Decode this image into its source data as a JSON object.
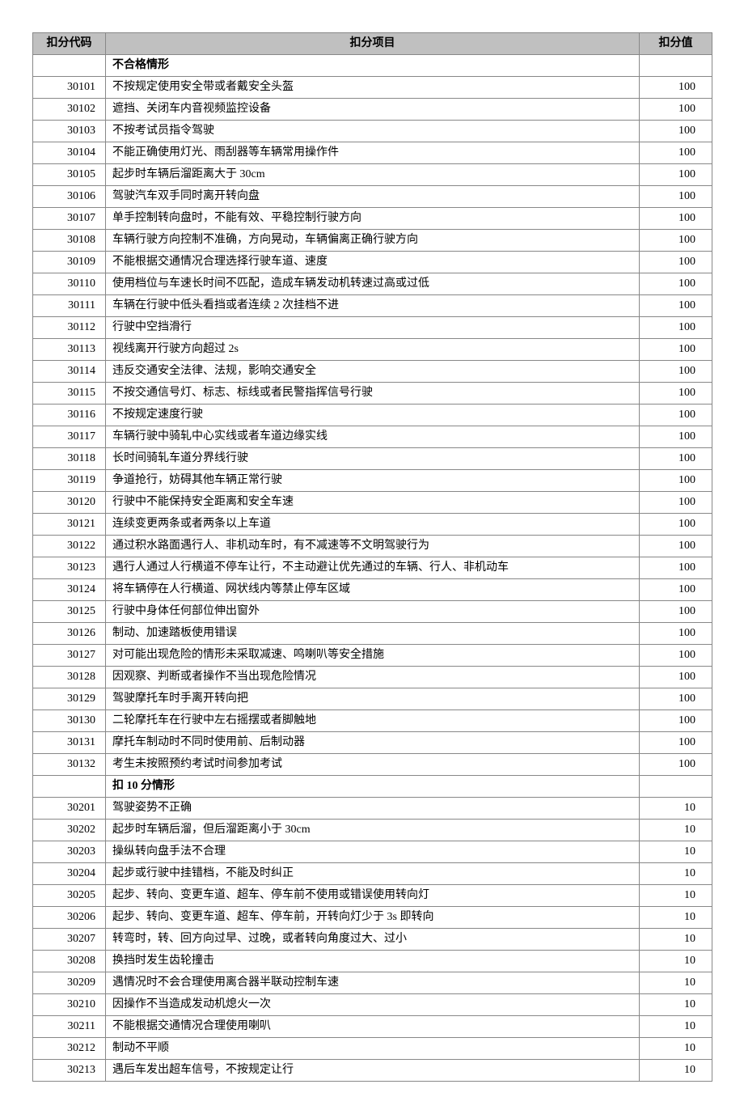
{
  "headers": {
    "code": "扣分代码",
    "item": "扣分项目",
    "value": "扣分值"
  },
  "sections": [
    {
      "title": "不合格情形",
      "rows": [
        {
          "code": "30101",
          "item": "不按规定使用安全带或者戴安全头盔",
          "value": "100"
        },
        {
          "code": "30102",
          "item": "遮挡、关闭车内音视频监控设备",
          "value": "100"
        },
        {
          "code": "30103",
          "item": "不按考试员指令驾驶",
          "value": "100"
        },
        {
          "code": "30104",
          "item": "不能正确使用灯光、雨刮器等车辆常用操作件",
          "value": "100"
        },
        {
          "code": "30105",
          "item": "起步时车辆后溜距离大于 30cm",
          "value": "100"
        },
        {
          "code": "30106",
          "item": "驾驶汽车双手同时离开转向盘",
          "value": "100"
        },
        {
          "code": "30107",
          "item": "单手控制转向盘时，不能有效、平稳控制行驶方向",
          "value": "100"
        },
        {
          "code": "30108",
          "item": "车辆行驶方向控制不准确，方向晃动，车辆偏离正确行驶方向",
          "value": "100"
        },
        {
          "code": "30109",
          "item": "不能根据交通情况合理选择行驶车道、速度",
          "value": "100"
        },
        {
          "code": "30110",
          "item": "使用档位与车速长时间不匹配，造成车辆发动机转速过高或过低",
          "value": "100"
        },
        {
          "code": "30111",
          "item": "车辆在行驶中低头看挡或者连续 2 次挂档不进",
          "value": "100"
        },
        {
          "code": "30112",
          "item": "行驶中空挡滑行",
          "value": "100"
        },
        {
          "code": "30113",
          "item": "视线离开行驶方向超过 2s",
          "value": "100"
        },
        {
          "code": "30114",
          "item": "违反交通安全法律、法规，影响交通安全",
          "value": "100"
        },
        {
          "code": "30115",
          "item": "不按交通信号灯、标志、标线或者民警指挥信号行驶",
          "value": "100"
        },
        {
          "code": "30116",
          "item": "不按规定速度行驶",
          "value": "100"
        },
        {
          "code": "30117",
          "item": "车辆行驶中骑轧中心实线或者车道边缘实线",
          "value": "100"
        },
        {
          "code": "30118",
          "item": "长时间骑轧车道分界线行驶",
          "value": "100"
        },
        {
          "code": "30119",
          "item": "争道抢行，妨碍其他车辆正常行驶",
          "value": "100"
        },
        {
          "code": "30120",
          "item": "行驶中不能保持安全距离和安全车速",
          "value": "100"
        },
        {
          "code": "30121",
          "item": "连续变更两条或者两条以上车道",
          "value": "100"
        },
        {
          "code": "30122",
          "item": "通过积水路面遇行人、非机动车时，有不减速等不文明驾驶行为",
          "value": "100"
        },
        {
          "code": "30123",
          "item": "遇行人通过人行横道不停车让行，不主动避让优先通过的车辆、行人、非机动车",
          "value": "100"
        },
        {
          "code": "30124",
          "item": "将车辆停在人行横道、网状线内等禁止停车区域",
          "value": "100"
        },
        {
          "code": "30125",
          "item": "行驶中身体任何部位伸出窗外",
          "value": "100"
        },
        {
          "code": "30126",
          "item": "制动、加速踏板使用错误",
          "value": "100"
        },
        {
          "code": "30127",
          "item": "对可能出现危险的情形未采取减速、鸣喇叭等安全措施",
          "value": "100"
        },
        {
          "code": "30128",
          "item": "因观察、判断或者操作不当出现危险情况",
          "value": "100"
        },
        {
          "code": "30129",
          "item": "驾驶摩托车时手离开转向把",
          "value": "100"
        },
        {
          "code": "30130",
          "item": "二轮摩托车在行驶中左右摇摆或者脚触地",
          "value": "100"
        },
        {
          "code": "30131",
          "item": "摩托车制动时不同时使用前、后制动器",
          "value": "100"
        },
        {
          "code": "30132",
          "item": "考生未按照预约考试时间参加考试",
          "value": "100"
        }
      ]
    },
    {
      "title": "扣 10 分情形",
      "rows": [
        {
          "code": "30201",
          "item": "驾驶姿势不正确",
          "value": "10"
        },
        {
          "code": "30202",
          "item": "起步时车辆后溜，但后溜距离小于 30cm",
          "value": "10"
        },
        {
          "code": "30203",
          "item": "操纵转向盘手法不合理",
          "value": "10"
        },
        {
          "code": "30204",
          "item": "起步或行驶中挂错档，不能及时纠正",
          "value": "10"
        },
        {
          "code": "30205",
          "item": "起步、转向、变更车道、超车、停车前不使用或错误使用转向灯",
          "value": "10"
        },
        {
          "code": "30206",
          "item": "起步、转向、变更车道、超车、停车前，开转向灯少于 3s 即转向",
          "value": "10"
        },
        {
          "code": "30207",
          "item": "转弯时，转、回方向过早、过晚，或者转向角度过大、过小",
          "value": "10"
        },
        {
          "code": "30208",
          "item": "换挡时发生齿轮撞击",
          "value": "10"
        },
        {
          "code": "30209",
          "item": "遇情况时不会合理使用离合器半联动控制车速",
          "value": "10"
        },
        {
          "code": "30210",
          "item": "因操作不当造成发动机熄火一次",
          "value": "10"
        },
        {
          "code": "30211",
          "item": "不能根据交通情况合理使用喇叭",
          "value": "10"
        },
        {
          "code": "30212",
          "item": "制动不平顺",
          "value": "10"
        },
        {
          "code": "30213",
          "item": "遇后车发出超车信号，不按规定让行",
          "value": "10"
        }
      ]
    }
  ]
}
